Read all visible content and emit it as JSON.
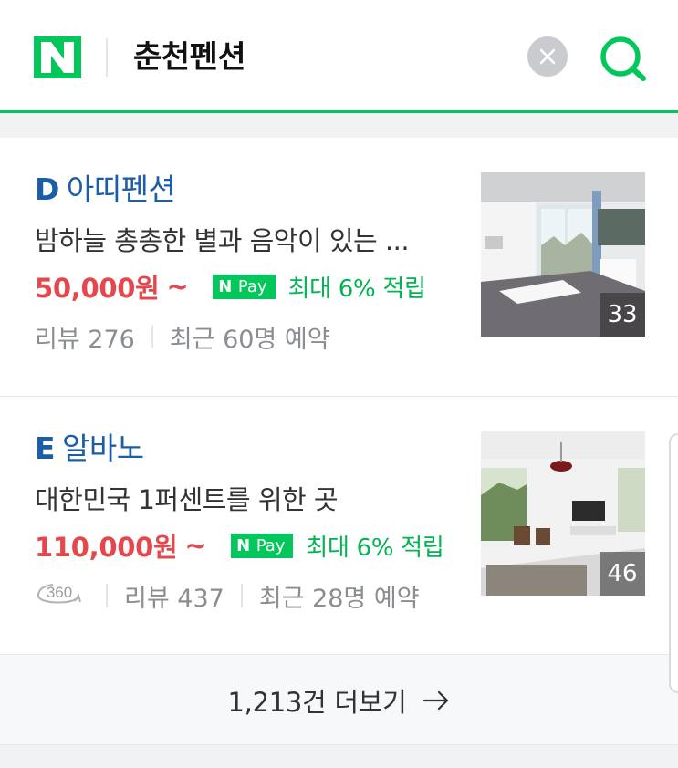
{
  "header": {
    "logo_letter": "N",
    "query": "춘천펜션",
    "brand_color": "#03c75a"
  },
  "results": [
    {
      "mark": "D",
      "name": "아띠펜션",
      "description": "밤하늘 총총한 별과 음악이 있는 ...",
      "price": "50,000원",
      "price_suffix": "~",
      "npay_n": "N",
      "npay_label": "Pay",
      "reward": "최대 6% 적립",
      "review": "리뷰 276",
      "recent": "최근 60명 예약",
      "photo_count": "33",
      "has_360": false
    },
    {
      "mark": "E",
      "name": "알바노",
      "description": "대한민국 1퍼센트를 위한 곳",
      "price": "110,000원",
      "price_suffix": "~",
      "npay_n": "N",
      "npay_label": "Pay",
      "reward": "최대 6% 적립",
      "review": "리뷰 437",
      "recent": "최근 28명 예약",
      "photo_count": "46",
      "has_360": true,
      "badge_360": "360"
    }
  ],
  "more": {
    "label": "1,213건 더보기",
    "arrow_icon": "arrow-right-icon"
  },
  "colors": {
    "title_blue": "#1a5ea8",
    "price_red": "#e4484c",
    "npay_green": "#03c75a",
    "reward_green": "#03b354",
    "meta_gray": "#8a8d91"
  }
}
